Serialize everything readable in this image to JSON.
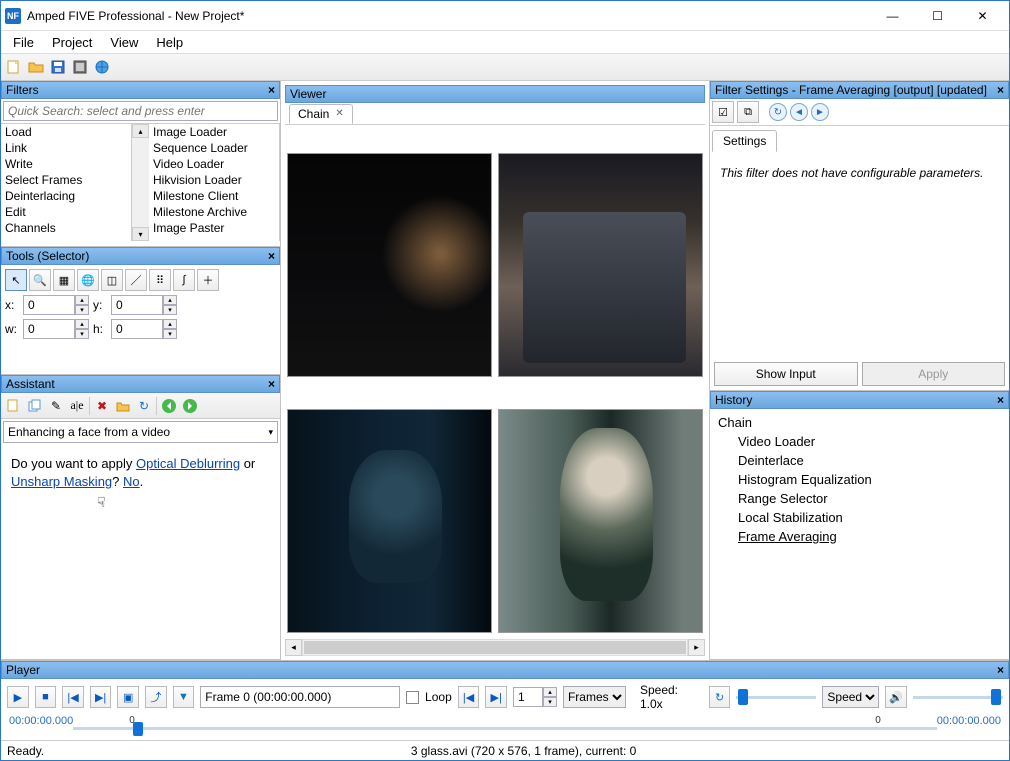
{
  "title": "Amped FIVE Professional - New Project*",
  "menu": {
    "file": "File",
    "project": "Project",
    "view": "View",
    "help": "Help"
  },
  "filters": {
    "title": "Filters",
    "search_placeholder": "Quick Search: select and press enter",
    "categories": [
      "Load",
      "Link",
      "Write",
      "Select Frames",
      "Deinterlacing",
      "Edit",
      "Channels"
    ],
    "items": [
      "Image Loader",
      "Sequence Loader",
      "Video Loader",
      "Hikvision Loader",
      "Milestone Client",
      "Milestone Archive",
      "Image Paster"
    ]
  },
  "tools": {
    "title": "Tools (Selector)",
    "x_label": "x:",
    "y_label": "y:",
    "w_label": "w:",
    "h_label": "h:",
    "x_val": "0",
    "y_val": "0",
    "w_val": "0",
    "h_val": "0"
  },
  "assistant": {
    "title": "Assistant",
    "mode": "Enhancing a face from a video",
    "q_prefix": "Do you want to apply ",
    "link1": "Optical Deblurring",
    "mid": " or ",
    "link2": "Unsharp Masking",
    "q_suffix": "? ",
    "no": "No",
    "dot": "."
  },
  "viewer": {
    "title": "Viewer",
    "tab": "Chain"
  },
  "filter_settings": {
    "title": "Filter Settings - Frame Averaging [output] [updated]",
    "tab": "Settings",
    "msg": "This filter does not have configurable parameters.",
    "show_input": "Show Input",
    "apply": "Apply"
  },
  "history": {
    "title": "History",
    "root": "Chain",
    "items": [
      "Video Loader",
      "Deinterlace",
      "Histogram Equalization",
      "Range Selector",
      "Local Stabilization",
      "Frame Averaging"
    ]
  },
  "player": {
    "title": "Player",
    "frame_text": "Frame 0 (00:00:00.000)",
    "loop": "Loop",
    "frames_val": "1",
    "unit": "Frames",
    "speed_label": "Speed: 1.0x",
    "speed_combo": "Speed",
    "t_start": "00:00:00.000",
    "t_end": "00:00:00.000",
    "tick0": "0",
    "tick1": "0"
  },
  "status": {
    "ready": "Ready.",
    "info": "3 glass.avi (720 x 576, 1 frame), current: 0"
  }
}
